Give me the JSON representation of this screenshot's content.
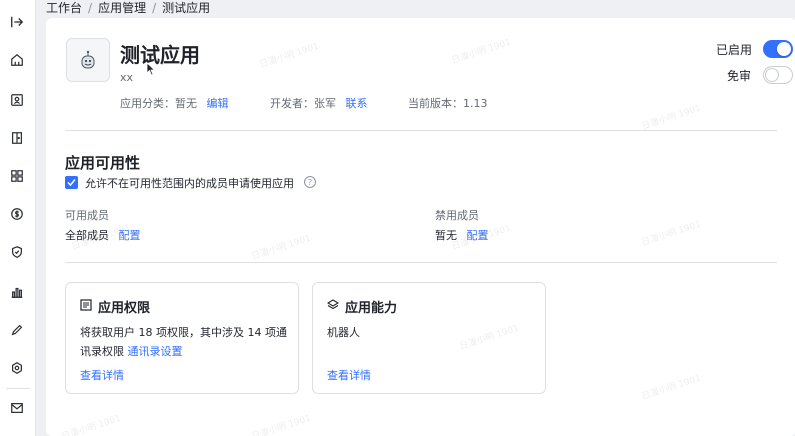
{
  "breadcrumb": [
    "工作台",
    "应用管理",
    "测试应用"
  ],
  "app": {
    "name": "测试应用",
    "desc": "xx",
    "category_label": "应用分类：暂无",
    "category_edit": "编辑",
    "developer_label": "开发者：张军",
    "developer_contact": "联系",
    "version_label": "当前版本：1.13"
  },
  "toggles": {
    "enabled_label": "已启用",
    "enabled": true,
    "exempt_label": "免审",
    "exempt": false
  },
  "availability": {
    "title": "应用可用性",
    "checkbox_label": "允许不在可用性范围内的成员申请使用应用",
    "checkbox_checked": true,
    "help": "?",
    "members_label": "可用成员",
    "members_value": "全部成员",
    "members_config": "配置",
    "banned_label": "禁用成员",
    "banned_value": "暂无",
    "banned_config": "配置"
  },
  "cards": [
    {
      "title": "应用权限",
      "body": "将获取用户 18 项权限，其中涉及 14 项通讯录权限",
      "link": "通讯录设置",
      "more": "查看详情"
    },
    {
      "title": "应用能力",
      "body": "机器人",
      "more": "查看详情"
    }
  ],
  "watermark": "日潘小明 1901",
  "colors": {
    "accent": "#3370ff",
    "text": "#1f2329",
    "muted": "#646a73"
  }
}
